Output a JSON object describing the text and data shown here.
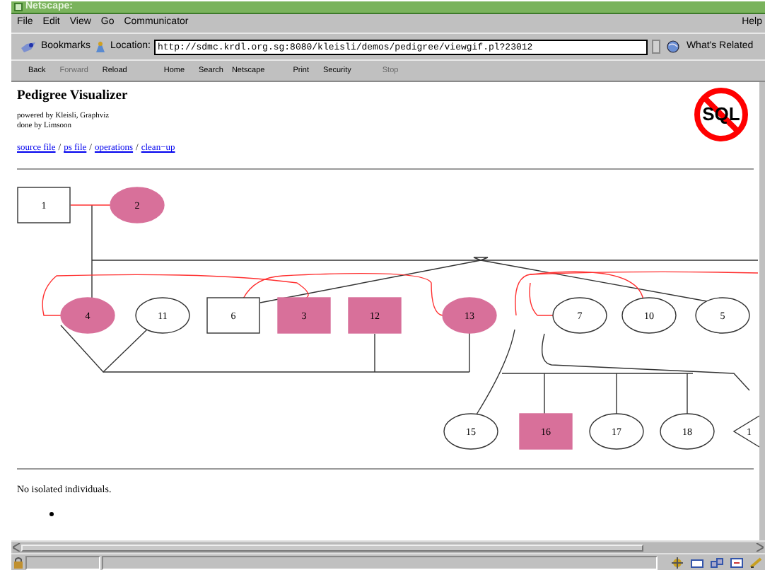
{
  "window": {
    "title": "Netscape:"
  },
  "menu": [
    {
      "label": "File"
    },
    {
      "label": "Edit"
    },
    {
      "label": "View"
    },
    {
      "label": "Go"
    },
    {
      "label": "Communicator"
    },
    {
      "label": "Help"
    }
  ],
  "location_bar": {
    "bookmarks": "Bookmarks",
    "location_label": "Location:",
    "url": "http://sdmc.krdl.org.sg:8080/kleisli/demos/pedigree/viewgif.pl?23012",
    "related": "What's Related"
  },
  "toolbar": [
    {
      "label": "Back",
      "disabled": false
    },
    {
      "label": "Forward",
      "disabled": true
    },
    {
      "label": "Reload",
      "disabled": false
    },
    {
      "label": "Home",
      "disabled": false
    },
    {
      "label": "Search",
      "disabled": false
    },
    {
      "label": "Netscape",
      "disabled": false
    },
    {
      "label": "Print",
      "disabled": false
    },
    {
      "label": "Security",
      "disabled": false
    },
    {
      "label": "Stop",
      "disabled": true
    }
  ],
  "page": {
    "title": "Pedigree Visualizer",
    "credits": [
      "powered by Kleisli, Graphviz",
      "done by Limsoon"
    ],
    "logo": "SQL",
    "links": [
      {
        "kind": "link",
        "text": "source file"
      },
      {
        "kind": "separator",
        "text": "/"
      },
      {
        "kind": "link",
        "text": "ps file"
      },
      {
        "kind": "separator",
        "text": "/"
      },
      {
        "kind": "link",
        "text": "operations"
      },
      {
        "kind": "separator",
        "text": "/"
      },
      {
        "kind": "link",
        "text": "clean−up"
      }
    ],
    "pedigree": {
      "nodes": [
        {
          "label": "1",
          "kind": "box",
          "color": "#ffffff"
        },
        {
          "label": "2",
          "kind": "oval",
          "color": "#d8709a"
        },
        {
          "label": "4",
          "kind": "oval",
          "color": "#d8709a"
        },
        {
          "label": "11",
          "kind": "oval",
          "color": "#ffffff"
        },
        {
          "label": "6",
          "kind": "box",
          "color": "#ffffff"
        },
        {
          "label": "3",
          "kind": "box",
          "color": "#d8709a"
        },
        {
          "label": "12",
          "kind": "box",
          "color": "#d8709a"
        },
        {
          "label": "13",
          "kind": "oval",
          "color": "#d8709a"
        },
        {
          "label": "7",
          "kind": "oval",
          "color": "#ffffff"
        },
        {
          "label": "10",
          "kind": "oval",
          "color": "#ffffff"
        },
        {
          "label": "5",
          "kind": "oval",
          "color": "#ffffff"
        },
        {
          "label": "15",
          "kind": "oval",
          "color": "#ffffff"
        },
        {
          "label": "16",
          "kind": "box",
          "color": "#d8709a"
        },
        {
          "label": "17",
          "kind": "oval",
          "color": "#ffffff"
        },
        {
          "label": "18",
          "kind": "oval",
          "color": "#ffffff"
        },
        {
          "label": "1",
          "kind": "triangle",
          "color": "#ffffff"
        }
      ]
    },
    "note": "No isolated individuals."
  }
}
